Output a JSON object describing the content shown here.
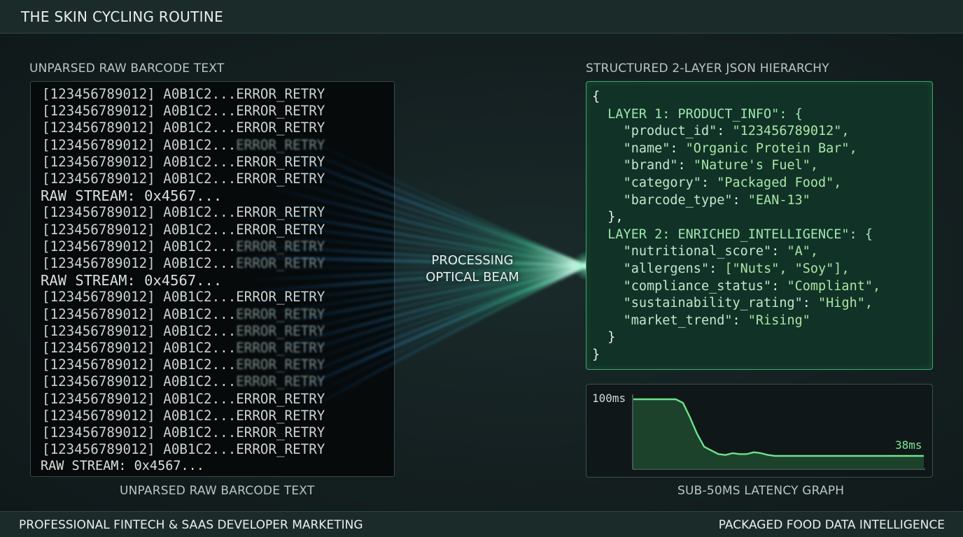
{
  "header": {
    "title": "THE SKIN CYCLING ROUTINE"
  },
  "raw_panel": {
    "heading": "UNPARSED RAW BARCODE TEXT",
    "caption": "UNPARSED RAW BARCODE TEXT",
    "lines": [
      "[123456789012] A0B1C2...ERROR_RETRY",
      "[123456789012] A0B1C2...ERROR_RETRY",
      "[123456789012] A0B1C2...ERROR_RETRY",
      "[123456789012] A0B1C2...ERROR_RETRY",
      "[123456789012] A0B1C2...ERROR_RETRY",
      "[123456789012] A0B1C2...ERROR_RETRY",
      "RAW STREAM: 0x4567...",
      "[123456789012] A0B1C2...ERROR_RETRY",
      "[123456789012] A0B1C2...ERROR_RETRY",
      "[123456789012] A0B1C2...ERROR_RETRY",
      "[123456789012] A0B1C2...ERROR_RETRY",
      "RAW STREAM: 0x4567...",
      "[123456789012] A0B1C2...ERROR_RETRY",
      "[123456789012] A0B1C2...ERROR_RETRY",
      "[123456789012] A0B1C2...ERROR_RETRY",
      "[123456789012] A0B1C2...ERROR_RETRY",
      "[123456789012] A0B1C2...ERROR_RETRY",
      "[123456789012] A0B1C2...ERROR_RETRY",
      "[123456789012] A0B1C2...ERROR_RETRY",
      "[123456789012] A0B1C2...ERROR_RETRY",
      "[123456789012] A0B1C2...ERROR_RETRY",
      "[123456789012] A0B1C2...ERROR_RETRY",
      "RAW STREAM: 0x4567..."
    ]
  },
  "beam": {
    "label_line1": "PROCESSING",
    "label_line2": "OPTICAL BEAM"
  },
  "json_panel": {
    "heading": "STRUCTURED 2-LAYER JSON HIERARCHY",
    "open_brace": "{",
    "layer1_header": "LAYER 1: PRODUCT_INFO\": {",
    "layer1": [
      {
        "key": "\"product_id\"",
        "value": "\"123456789012\","
      },
      {
        "key": "\"name\"",
        "value": "\"Organic Protein Bar\","
      },
      {
        "key": "\"brand\"",
        "value": "\"Nature's Fuel\","
      },
      {
        "key": "\"category\"",
        "value": "\"Packaged Food\","
      },
      {
        "key": "\"barcode_type\"",
        "value": "\"EAN-13\""
      }
    ],
    "layer1_close": "},",
    "layer2_header": "LAYER 2: ENRICHED_INTELLIGENCE\": {",
    "layer2": [
      {
        "key": "\"nutritional_score\"",
        "value": "\"A\","
      },
      {
        "key": "\"allergens\"",
        "value": "[\"Nuts\", \"Soy\"],"
      },
      {
        "key": "\"compliance_status\"",
        "value": "\"Compliant\","
      },
      {
        "key": "\"sustainability_rating\"",
        "value": "\"High\","
      },
      {
        "key": "\"market_trend\"",
        "value": "\"Rising\""
      }
    ],
    "layer2_close": "}",
    "close_brace": "}"
  },
  "latency_graph": {
    "caption": "SUB-50MS LATENCY GRAPH",
    "y_label": "100ms",
    "end_label": "38ms",
    "colors": {
      "line": "#6fe28a",
      "fill": "#1e4a30"
    },
    "chart_data": {
      "type": "area",
      "y_top_label": "100ms",
      "end_value_label": "38ms",
      "values_ms": [
        100,
        100,
        100,
        100,
        100,
        100,
        100,
        96,
        80,
        62,
        48,
        44,
        40,
        39,
        41,
        40,
        40,
        42,
        41,
        39,
        38,
        38,
        38,
        38,
        38,
        38,
        38,
        38,
        38,
        38,
        38,
        38,
        38,
        38,
        38,
        38,
        38,
        38,
        38,
        38,
        38,
        38
      ]
    }
  },
  "footer": {
    "left": "PROFESSIONAL FINTECH & SAAS DEVELOPER MARKETING",
    "right": "PACKAGED FOOD DATA INTELLIGENCE"
  }
}
